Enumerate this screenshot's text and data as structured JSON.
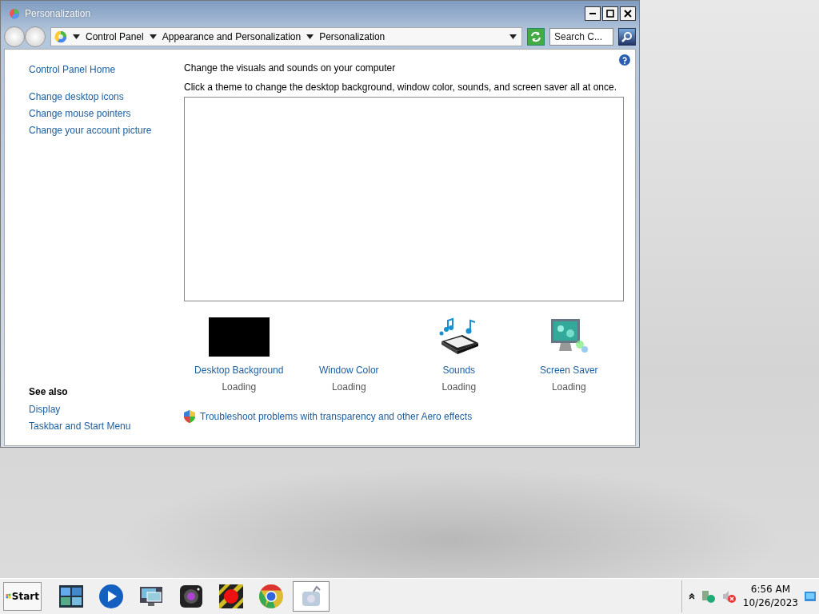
{
  "window": {
    "title": "Personalization"
  },
  "address_bar": {
    "breadcrumbs": [
      "Control Panel",
      "Appearance and Personalization",
      "Personalization"
    ]
  },
  "search": {
    "placeholder": "Search C..."
  },
  "sidebar": {
    "links": [
      "Control Panel Home",
      "Change desktop icons",
      "Change mouse pointers",
      "Change your account picture"
    ],
    "see_also_heading": "See also",
    "see_also": [
      "Display",
      "Taskbar and Start Menu"
    ]
  },
  "main": {
    "heading": "Change the visuals and sounds on your computer",
    "description": "Click a theme to change the desktop background, window color, sounds, and screen saver all at once.",
    "items": [
      {
        "kind": "background",
        "label": "Desktop Background",
        "status": "Loading"
      },
      {
        "kind": "color",
        "label": "Window Color",
        "status": "Loading"
      },
      {
        "kind": "sounds",
        "label": "Sounds",
        "status": "Loading"
      },
      {
        "kind": "screensaver",
        "label": "Screen Saver",
        "status": "Loading"
      }
    ],
    "troubleshoot_link": "Troubleshoot problems with transparency and other Aero effects"
  },
  "taskbar": {
    "start": "Start",
    "apps": [
      {
        "kind": "gallery",
        "selected": false
      },
      {
        "kind": "play",
        "selected": false
      },
      {
        "kind": "monitor",
        "selected": false
      },
      {
        "kind": "camera",
        "selected": false
      },
      {
        "kind": "record",
        "selected": false
      },
      {
        "kind": "chrome",
        "selected": false
      },
      {
        "kind": "control",
        "selected": true
      }
    ],
    "clock": {
      "time": "6:56 AM",
      "date": "10/26/2023"
    }
  }
}
